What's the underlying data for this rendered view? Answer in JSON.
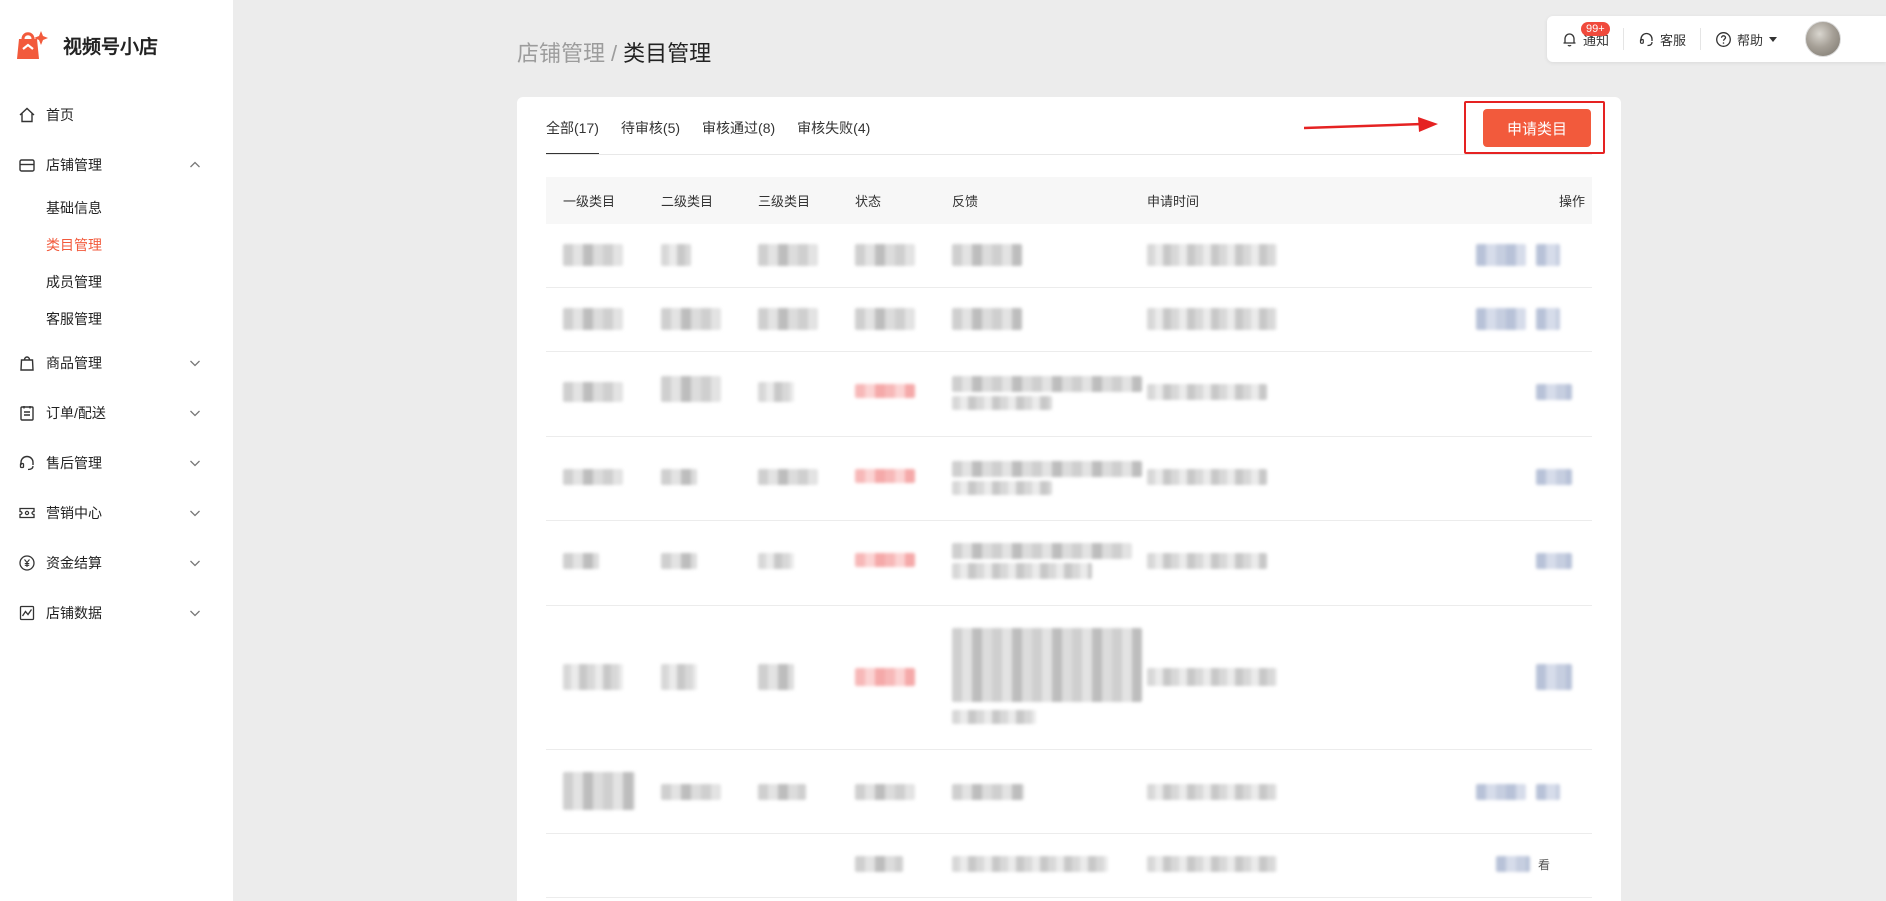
{
  "brand": {
    "name": "视频号小店",
    "color": "#f25a3c"
  },
  "sidebar": {
    "items": [
      {
        "label": "首页",
        "icon": "home-icon"
      },
      {
        "label": "店铺管理",
        "icon": "store-icon",
        "expanded": true,
        "children": [
          "基础信息",
          "类目管理",
          "成员管理",
          "客服管理"
        ],
        "active_child": "类目管理"
      },
      {
        "label": "商品管理",
        "icon": "bag-icon"
      },
      {
        "label": "订单/配送",
        "icon": "clipboard-icon"
      },
      {
        "label": "售后管理",
        "icon": "headset-icon"
      },
      {
        "label": "营销中心",
        "icon": "ticket-icon"
      },
      {
        "label": "资金结算",
        "icon": "yen-icon"
      },
      {
        "label": "店铺数据",
        "icon": "chart-icon"
      }
    ]
  },
  "topbar": {
    "notify_label": "通知",
    "notify_badge": "99+",
    "service_label": "客服",
    "help_label": "帮助"
  },
  "breadcrumb": {
    "parent": "店铺管理",
    "separator": "/",
    "current": "类目管理"
  },
  "tabs": [
    "全部(17)",
    "待审核(5)",
    "审核通过(8)",
    "审核失败(4)"
  ],
  "active_tab": "全部(17)",
  "apply_button": "申请类目",
  "table": {
    "headers": [
      "一级类目",
      "二级类目",
      "三级类目",
      "状态",
      "反馈",
      "申请时间",
      "操作"
    ]
  },
  "colors": {
    "accent": "#f25a3c",
    "highlight_box": "#e52222",
    "badge": "#f04a3c"
  },
  "last_row_action": "看"
}
